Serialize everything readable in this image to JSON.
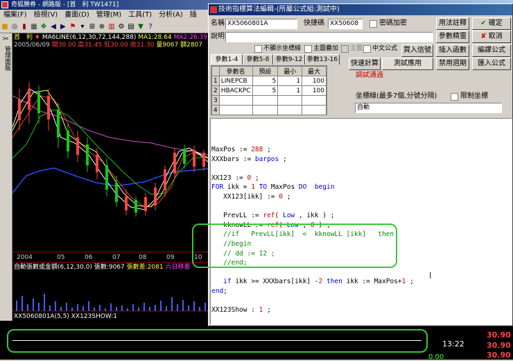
{
  "app": {
    "title": "奇狐勝券 - 網路版 - [首　利 TW1471]",
    "menu": [
      "檔案(F)",
      "檢視(V)",
      "畫面(D)",
      "管理(M)",
      "工具(T)",
      "分析(A)",
      "插"
    ],
    "side_label": "管理面版"
  },
  "chart": {
    "stock_title": "首　利",
    "ma_line": "MA6LINE(6,12,30,72,144,288)",
    "ma1": "MA1:28.64",
    "ma2": "MA2:26.39",
    "ma3_prefix": "M",
    "date": "2005/06/09",
    "open": "開30.00",
    "high": "高31.45",
    "low": "低30.00",
    "close": "收31.30",
    "volume": "量9067",
    "amount": "額2807",
    "x_labels": [
      "2004",
      "05",
      "06",
      "07",
      "08",
      "09",
      "10"
    ],
    "sub_title": "自動張數或金額(6,12,30,0)",
    "sub_vol": "張數:9067",
    "sub_diff": "張數差:2081",
    "sub_extra": "六日移差",
    "indicator_label": "XX5060801A(5,5) XX123SHOW:1",
    "time": "13:22",
    "price_row1": "30.90",
    "price_row2": "30.90",
    "price_pct": "0.00"
  },
  "dialog": {
    "title": "技術指標算法編輯-(所屬公式組:測試中)",
    "name_label": "名稱",
    "name_value": "XX5060801A",
    "hotkey_label": "快捷碼",
    "hotkey_value": "XX50608",
    "password_label": "密碼加密",
    "desc_label": "說明",
    "hide_axis_label": "不顯示坐標線",
    "overlay_label": "主圖疊加",
    "main_label": "主圖",
    "center_axis_label": "中文公式",
    "buy_label": "買入信號",
    "tabs": [
      "參數1-4",
      "參數5-8",
      "參數9-12",
      "參數13-16"
    ],
    "grid_headers": [
      "參數名",
      "預設",
      "最小",
      "最大"
    ],
    "params": [
      {
        "idx": "1",
        "name": "LINEPCB",
        "default": "5",
        "min": "1",
        "max": "100"
      },
      {
        "idx": "2",
        "name": "HBACKPC",
        "default": "5",
        "min": "1",
        "max": "100"
      },
      {
        "idx": "3",
        "name": "",
        "default": "",
        "min": "",
        "max": ""
      },
      {
        "idx": "4",
        "name": "",
        "default": "",
        "min": "",
        "max": ""
      }
    ],
    "status_msg": "調試通過",
    "buttons": {
      "usage": "用法註釋",
      "ok": "確定",
      "param_tune": "參數精靈",
      "cancel": "取消",
      "insert_func": "插入函數",
      "compile": "編譯公式",
      "quick_calc": "快速計算",
      "test_use": "測試應用",
      "disable_period": "禁用週期",
      "import": "匯入公式"
    },
    "axis_label": "坐標線(最多7個,分號分隔)",
    "limit_axis_label": "限制坐標",
    "axis_value": "自動"
  },
  "code": [
    [
      {
        "t": "MaxPos := "
      },
      {
        "t": "288",
        "c": "num"
      },
      {
        "t": " ;"
      }
    ],
    [
      {
        "t": "XXXbars := "
      },
      {
        "t": "barpos",
        "c": "kw"
      },
      {
        "t": " ;"
      }
    ],
    [
      {
        "t": ""
      }
    ],
    [
      {
        "t": "XX123 := "
      },
      {
        "t": "0",
        "c": "num"
      },
      {
        "t": " ;"
      }
    ],
    [
      {
        "t": "FOR",
        "c": "kw"
      },
      {
        "t": " ikk = "
      },
      {
        "t": "1",
        "c": "num"
      },
      {
        "t": " "
      },
      {
        "t": "TO",
        "c": "kw"
      },
      {
        "t": " MaxPos "
      },
      {
        "t": "DO",
        "c": "kw"
      },
      {
        "t": "  "
      },
      {
        "t": "begin",
        "c": "kw"
      }
    ],
    [
      {
        "t": "   XX123[ikk] := "
      },
      {
        "t": "0",
        "c": "num"
      },
      {
        "t": " ;"
      }
    ],
    [
      {
        "t": ""
      }
    ],
    [
      {
        "t": "   PrevLL := "
      },
      {
        "t": "ref",
        "c": "fn"
      },
      {
        "t": "( "
      },
      {
        "t": "Low",
        "c": "kw"
      },
      {
        "t": " , ikk ) ;"
      }
    ],
    [
      {
        "t": "   kknowLL := "
      },
      {
        "t": "ref",
        "c": "fn"
      },
      {
        "t": "( "
      },
      {
        "t": "Low",
        "c": "kw"
      },
      {
        "t": " , "
      },
      {
        "t": "0",
        "c": "num"
      },
      {
        "t": " ) ;"
      }
    ],
    [
      {
        "t": "   //if   PrevLL[ikk]  <  kknowLL [ikk]   then",
        "c": "cm"
      }
    ],
    [
      {
        "t": "   //begin",
        "c": "cm"
      }
    ],
    [
      {
        "t": "   // dd := 12 ;",
        "c": "cm"
      }
    ],
    [
      {
        "t": "   //end;",
        "c": "cm"
      }
    ],
    [
      {
        "t": ""
      }
    ],
    [
      {
        "t": "   "
      },
      {
        "t": "if",
        "c": "kw"
      },
      {
        "t": " ikk >= XXXbars[ikk] -"
      },
      {
        "t": "2",
        "c": "num"
      },
      {
        "t": " "
      },
      {
        "t": "then",
        "c": "kw"
      },
      {
        "t": " ikk := MaxPos+"
      },
      {
        "t": "1",
        "c": "num"
      },
      {
        "t": " ;"
      }
    ],
    [
      {
        "t": "end",
        "c": "kw"
      },
      {
        "t": ";"
      }
    ],
    [
      {
        "t": ""
      }
    ],
    [
      {
        "t": "XX123Show : "
      },
      {
        "t": "1",
        "c": "num"
      },
      {
        "t": " ;"
      }
    ]
  ]
}
